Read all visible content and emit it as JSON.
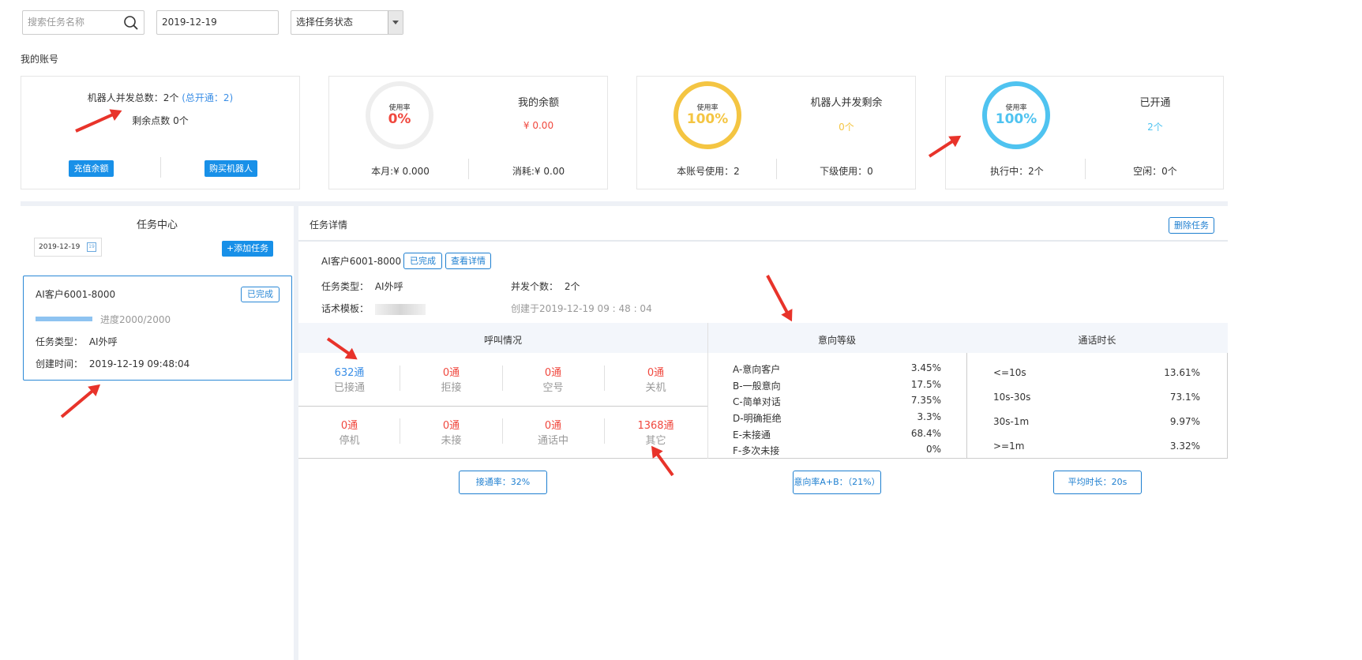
{
  "toolbar": {
    "search_placeholder": "搜索任务名称",
    "date_value": "2019-12-19",
    "status_placeholder": "选择任务状态"
  },
  "account": {
    "section_title": "我的账号",
    "robot_total_label": "机器人并发总数：",
    "robot_total_value": "2个",
    "robot_opened": "(总开通：2)",
    "remaining_points": "剩余点数 0个",
    "recharge_button": "充值余额",
    "buy_robot_button": "购买机器人"
  },
  "cards": [
    {
      "ring_label": "使用率",
      "ring_value": "0%",
      "title": "我的余额",
      "value": "¥ 0.00",
      "left_stat": "本月:¥ 0.000",
      "right_stat": "消耗:¥ 0.00",
      "color": "#f0483e",
      "ring_color": "#eeeeee",
      "fill": 0
    },
    {
      "ring_label": "使用率",
      "ring_value": "100%",
      "title": "机器人并发剩余",
      "value": "0个",
      "left_stat": "本账号使用：2",
      "right_stat": "下级使用：0",
      "color": "#f4c542",
      "ring_color": "#f4c542",
      "fill": 1
    },
    {
      "ring_label": "使用率",
      "ring_value": "100%",
      "title": "已开通",
      "value": "2个",
      "left_stat": "执行中：2个",
      "right_stat": "空闲：0个",
      "color": "#4fc3f0",
      "ring_color": "#4fc3f0",
      "fill": 1
    }
  ],
  "task_center": {
    "title": "任务中心",
    "date_value": "2019-12-19",
    "calendar_day": "19",
    "add_button": "+添加任务",
    "task": {
      "name": "AI客户6001-8000",
      "status": "已完成",
      "progress_text": "进度2000/2000",
      "progress": 1.0,
      "type_label": "任务类型：",
      "type_value": "AI外呼",
      "created_label": "创建时间：",
      "created_value": "2019-12-19 09:48:04"
    }
  },
  "detail": {
    "title": "任务详情",
    "delete_button": "删除任务",
    "task_name": "AI客户6001-8000",
    "status_button": "已完成",
    "view_button": "查看详情",
    "type_label": "任务类型：",
    "type_value": "AI外呼",
    "concurrency_label": "并发个数：",
    "concurrency_value": "2个",
    "template_label": "话术模板：",
    "created_text": "创建于2019-12-19 09 : 48 : 04",
    "call_header": "呼叫情况",
    "intent_header": "意向等级",
    "duration_header": "通话时长",
    "calls_row1": [
      {
        "num": "632通",
        "label": "已接通"
      },
      {
        "num": "0通",
        "label": "拒接"
      },
      {
        "num": "0通",
        "label": "空号"
      },
      {
        "num": "0通",
        "label": "关机"
      }
    ],
    "calls_row2": [
      {
        "num": "0通",
        "label": "停机"
      },
      {
        "num": "0通",
        "label": "未接"
      },
      {
        "num": "0通",
        "label": "通话中"
      },
      {
        "num": "1368通",
        "label": "其它"
      }
    ],
    "intent": [
      {
        "label": "A-意向客户",
        "value": "3.45%"
      },
      {
        "label": "B-一般意向",
        "value": "17.5%"
      },
      {
        "label": "C-简单对话",
        "value": "7.35%"
      },
      {
        "label": "D-明确拒绝",
        "value": "3.3%"
      },
      {
        "label": "E-未接通",
        "value": "68.4%"
      },
      {
        "label": "F-多次未接",
        "value": "0%"
      }
    ],
    "duration": [
      {
        "label": "<=10s",
        "value": "13.61%"
      },
      {
        "label": "10s-30s",
        "value": "73.1%"
      },
      {
        "label": "30s-1m",
        "value": "9.97%"
      },
      {
        "label": ">=1m",
        "value": "3.32%"
      }
    ],
    "connect_rate_button": "接通率：32%",
    "intent_rate_button": "意向率A+B：（21%）",
    "avg_duration_button": "平均时长：20s"
  }
}
